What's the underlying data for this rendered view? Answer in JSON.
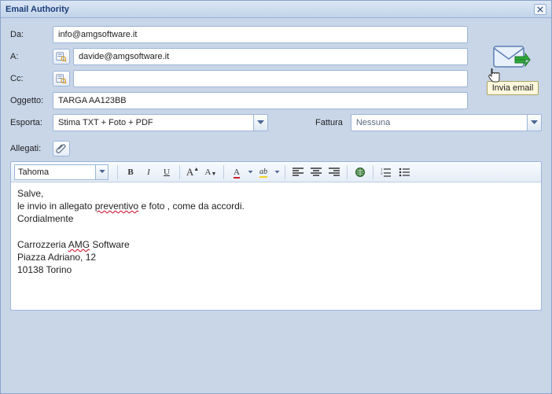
{
  "window": {
    "title": "Email Authority"
  },
  "labels": {
    "from": "Da:",
    "to": "A:",
    "cc": "Cc:",
    "subject": "Oggetto:",
    "export": "Esporta:",
    "invoice": "Fattura",
    "attachments": "Allegati:"
  },
  "fields": {
    "from": "info@amgsoftware.it",
    "to": "davide@amgsoftware.it",
    "cc": "",
    "subject": "TARGA AA123BB"
  },
  "export": {
    "selected": "Stima TXT + Foto + PDF"
  },
  "invoice": {
    "selected": "Nessuna"
  },
  "send": {
    "tooltip": "Invia email"
  },
  "editor": {
    "font": "Tahoma",
    "body_line1": "Salve,",
    "body_line2_pre": "le invio in allegato ",
    "body_line2_mis": "preventivo",
    "body_line2_post": " e foto , come da accordi.",
    "body_line3": "Cordialmente",
    "sig_line1_pre": "Carrozzeria ",
    "sig_line1_mis": "AMG",
    "sig_line1_post": " Software",
    "sig_line2": "Piazza Adriano, 12",
    "sig_line3": "10138 Torino"
  }
}
